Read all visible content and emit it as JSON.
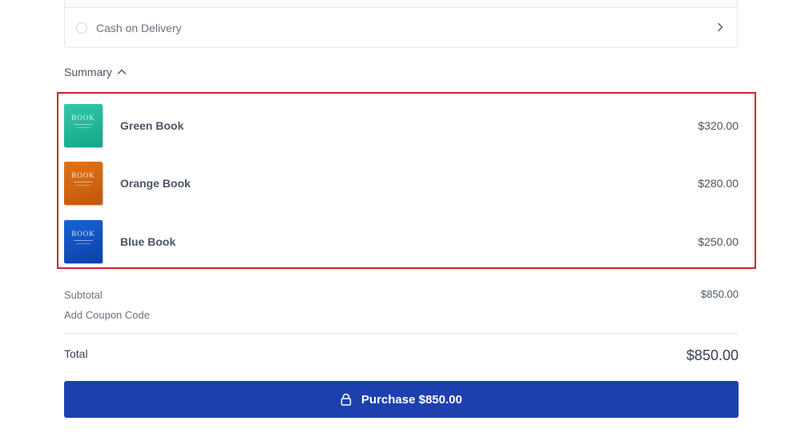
{
  "payment": {
    "option_label": "Cash on Delivery",
    "chevron_icon": "chevron-right-icon"
  },
  "summary": {
    "toggle_label": "Summary",
    "toggle_icon": "chevron-up-icon",
    "items": [
      {
        "name": "Green Book",
        "price": "$320.00",
        "cover_text": "BOOK",
        "cover_color": "#1fb896"
      },
      {
        "name": "Orange Book",
        "price": "$280.00",
        "cover_text": "BOOK",
        "cover_color": "#d66511"
      },
      {
        "name": "Blue Book",
        "price": "$250.00",
        "cover_text": "BOOK",
        "cover_color": "#1250c0"
      }
    ],
    "highlight_color": "#d3202a"
  },
  "totals": {
    "subtotal_label": "Subtotal",
    "subtotal_value": "$850.00",
    "coupon_label": "Add Coupon Code",
    "total_label": "Total",
    "total_value": "$850.00"
  },
  "purchase": {
    "label": "Purchase $850.00",
    "icon": "lock-icon",
    "color": "#1e40af"
  }
}
